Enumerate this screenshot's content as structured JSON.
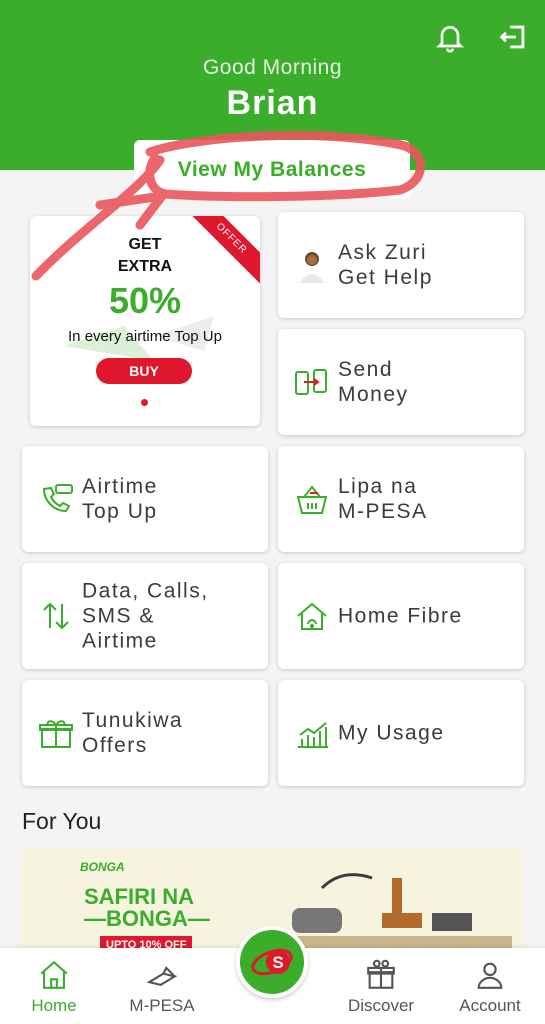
{
  "header": {
    "greeting": "Good Morning",
    "username": "Brian",
    "balances_label": "View My Balances"
  },
  "promo": {
    "badge": "OFFER",
    "line1": "GET",
    "line2": "EXTRA",
    "percent": "50%",
    "subtitle": "In every airtime Top Up",
    "button": "BUY"
  },
  "tiles": {
    "zuri_1": "Ask Zuri",
    "zuri_2": "Get Help",
    "send_1": "Send",
    "send_2": "Money",
    "airtime_1": "Airtime",
    "airtime_2": "Top Up",
    "lipa_1": "Lipa na",
    "lipa_2": "M-PESA",
    "data_1": "Data, Calls,",
    "data_2": "SMS &",
    "data_3": "Airtime",
    "fibre": "Home Fibre",
    "tunukiwa_1": "Tunukiwa",
    "tunukiwa_2": "Offers",
    "usage": "My Usage"
  },
  "for_you": {
    "title": "For You",
    "banner_logo": "BONGA",
    "banner_line1": "SAFIRI NA",
    "banner_line2": "—BONGA—",
    "banner_discount": "UPTO 10% OFF"
  },
  "nav": {
    "home": "Home",
    "mpesa": "M-PESA",
    "discover": "Discover",
    "account": "Account"
  },
  "colors": {
    "brand_green": "#3aad2a",
    "accent_red": "#e0182d"
  }
}
